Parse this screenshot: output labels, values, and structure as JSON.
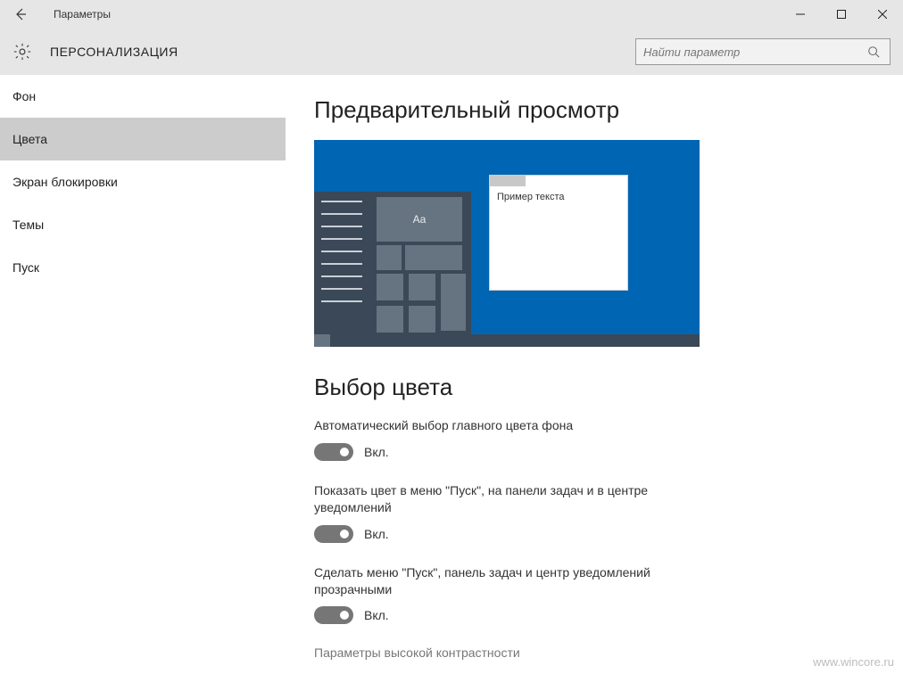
{
  "titlebar": {
    "title": "Параметры"
  },
  "header": {
    "category": "ПЕРСОНАЛИЗАЦИЯ",
    "search_placeholder": "Найти параметр"
  },
  "sidebar": {
    "items": [
      {
        "label": "Фон"
      },
      {
        "label": "Цвета"
      },
      {
        "label": "Экран блокировки"
      },
      {
        "label": "Темы"
      },
      {
        "label": "Пуск"
      }
    ],
    "selected_index": 1
  },
  "content": {
    "preview_heading": "Предварительный просмотр",
    "preview_tile_text": "Aa",
    "preview_window_text": "Пример текста",
    "color_heading": "Выбор цвета",
    "toggles": [
      {
        "label": "Автоматический выбор главного цвета фона",
        "state": "Вкл.",
        "on": true
      },
      {
        "label": "Показать цвет в меню \"Пуск\", на панели задач и в центре уведомлений",
        "state": "Вкл.",
        "on": true
      },
      {
        "label": "Сделать меню \"Пуск\", панель задач и центр уведомлений прозрачными",
        "state": "Вкл.",
        "on": true
      }
    ],
    "high_contrast_link": "Параметры высокой контрастности"
  },
  "watermark": "www.wincore.ru"
}
